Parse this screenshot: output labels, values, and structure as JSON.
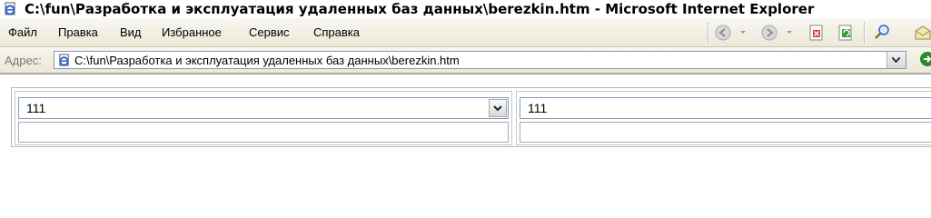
{
  "window": {
    "title": "C:\\fun\\Разработка и эксплуатация удаленных баз данных\\berezkin.htm - Microsoft Internet Explorer",
    "icon": "ie-page-icon"
  },
  "menu": {
    "items": [
      "Файл",
      "Правка",
      "Вид",
      "Избранное",
      "Сервис",
      "Справка"
    ]
  },
  "toolbar": {
    "buttons": [
      "back-icon",
      "forward-icon",
      "stop-icon",
      "refresh-icon",
      "search-icon",
      "mail-icon"
    ]
  },
  "address": {
    "label": "Адрес:",
    "url": "C:\\fun\\Разработка и эксплуатация удаленных баз данных\\berezkin.htm"
  },
  "form": {
    "left_select_value": "111",
    "right_select_value": "111"
  },
  "colors": {
    "chrome": "#ece9d8",
    "input_border": "#7f9db9"
  }
}
